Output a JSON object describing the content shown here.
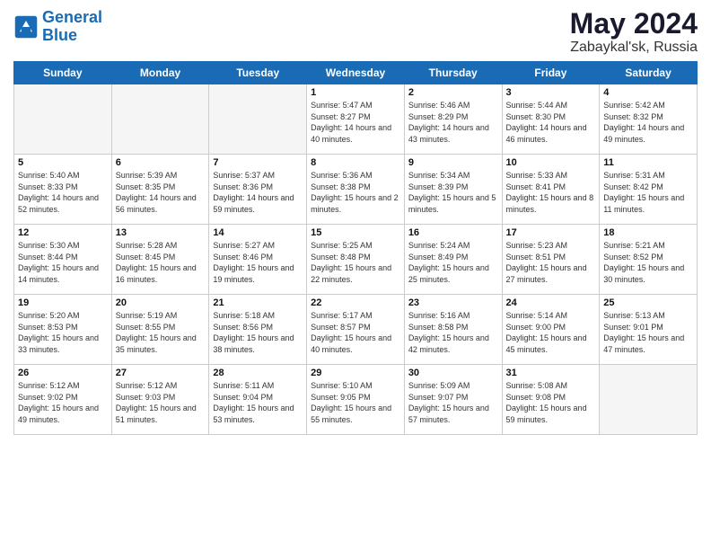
{
  "logo": {
    "line1": "General",
    "line2": "Blue"
  },
  "title": "May 2024",
  "subtitle": "Zabaykal'sk, Russia",
  "days_header": [
    "Sunday",
    "Monday",
    "Tuesday",
    "Wednesday",
    "Thursday",
    "Friday",
    "Saturday"
  ],
  "weeks": [
    [
      {
        "num": "",
        "empty": true
      },
      {
        "num": "",
        "empty": true
      },
      {
        "num": "",
        "empty": true
      },
      {
        "num": "1",
        "sunrise": "5:47 AM",
        "sunset": "8:27 PM",
        "daylight": "14 hours and 40 minutes."
      },
      {
        "num": "2",
        "sunrise": "5:46 AM",
        "sunset": "8:29 PM",
        "daylight": "14 hours and 43 minutes."
      },
      {
        "num": "3",
        "sunrise": "5:44 AM",
        "sunset": "8:30 PM",
        "daylight": "14 hours and 46 minutes."
      },
      {
        "num": "4",
        "sunrise": "5:42 AM",
        "sunset": "8:32 PM",
        "daylight": "14 hours and 49 minutes."
      }
    ],
    [
      {
        "num": "5",
        "sunrise": "5:40 AM",
        "sunset": "8:33 PM",
        "daylight": "14 hours and 52 minutes."
      },
      {
        "num": "6",
        "sunrise": "5:39 AM",
        "sunset": "8:35 PM",
        "daylight": "14 hours and 56 minutes."
      },
      {
        "num": "7",
        "sunrise": "5:37 AM",
        "sunset": "8:36 PM",
        "daylight": "14 hours and 59 minutes."
      },
      {
        "num": "8",
        "sunrise": "5:36 AM",
        "sunset": "8:38 PM",
        "daylight": "15 hours and 2 minutes."
      },
      {
        "num": "9",
        "sunrise": "5:34 AM",
        "sunset": "8:39 PM",
        "daylight": "15 hours and 5 minutes."
      },
      {
        "num": "10",
        "sunrise": "5:33 AM",
        "sunset": "8:41 PM",
        "daylight": "15 hours and 8 minutes."
      },
      {
        "num": "11",
        "sunrise": "5:31 AM",
        "sunset": "8:42 PM",
        "daylight": "15 hours and 11 minutes."
      }
    ],
    [
      {
        "num": "12",
        "sunrise": "5:30 AM",
        "sunset": "8:44 PM",
        "daylight": "15 hours and 14 minutes."
      },
      {
        "num": "13",
        "sunrise": "5:28 AM",
        "sunset": "8:45 PM",
        "daylight": "15 hours and 16 minutes."
      },
      {
        "num": "14",
        "sunrise": "5:27 AM",
        "sunset": "8:46 PM",
        "daylight": "15 hours and 19 minutes."
      },
      {
        "num": "15",
        "sunrise": "5:25 AM",
        "sunset": "8:48 PM",
        "daylight": "15 hours and 22 minutes."
      },
      {
        "num": "16",
        "sunrise": "5:24 AM",
        "sunset": "8:49 PM",
        "daylight": "15 hours and 25 minutes."
      },
      {
        "num": "17",
        "sunrise": "5:23 AM",
        "sunset": "8:51 PM",
        "daylight": "15 hours and 27 minutes."
      },
      {
        "num": "18",
        "sunrise": "5:21 AM",
        "sunset": "8:52 PM",
        "daylight": "15 hours and 30 minutes."
      }
    ],
    [
      {
        "num": "19",
        "sunrise": "5:20 AM",
        "sunset": "8:53 PM",
        "daylight": "15 hours and 33 minutes."
      },
      {
        "num": "20",
        "sunrise": "5:19 AM",
        "sunset": "8:55 PM",
        "daylight": "15 hours and 35 minutes."
      },
      {
        "num": "21",
        "sunrise": "5:18 AM",
        "sunset": "8:56 PM",
        "daylight": "15 hours and 38 minutes."
      },
      {
        "num": "22",
        "sunrise": "5:17 AM",
        "sunset": "8:57 PM",
        "daylight": "15 hours and 40 minutes."
      },
      {
        "num": "23",
        "sunrise": "5:16 AM",
        "sunset": "8:58 PM",
        "daylight": "15 hours and 42 minutes."
      },
      {
        "num": "24",
        "sunrise": "5:14 AM",
        "sunset": "9:00 PM",
        "daylight": "15 hours and 45 minutes."
      },
      {
        "num": "25",
        "sunrise": "5:13 AM",
        "sunset": "9:01 PM",
        "daylight": "15 hours and 47 minutes."
      }
    ],
    [
      {
        "num": "26",
        "sunrise": "5:12 AM",
        "sunset": "9:02 PM",
        "daylight": "15 hours and 49 minutes."
      },
      {
        "num": "27",
        "sunrise": "5:12 AM",
        "sunset": "9:03 PM",
        "daylight": "15 hours and 51 minutes."
      },
      {
        "num": "28",
        "sunrise": "5:11 AM",
        "sunset": "9:04 PM",
        "daylight": "15 hours and 53 minutes."
      },
      {
        "num": "29",
        "sunrise": "5:10 AM",
        "sunset": "9:05 PM",
        "daylight": "15 hours and 55 minutes."
      },
      {
        "num": "30",
        "sunrise": "5:09 AM",
        "sunset": "9:07 PM",
        "daylight": "15 hours and 57 minutes."
      },
      {
        "num": "31",
        "sunrise": "5:08 AM",
        "sunset": "9:08 PM",
        "daylight": "15 hours and 59 minutes."
      },
      {
        "num": "",
        "empty": true
      }
    ]
  ]
}
